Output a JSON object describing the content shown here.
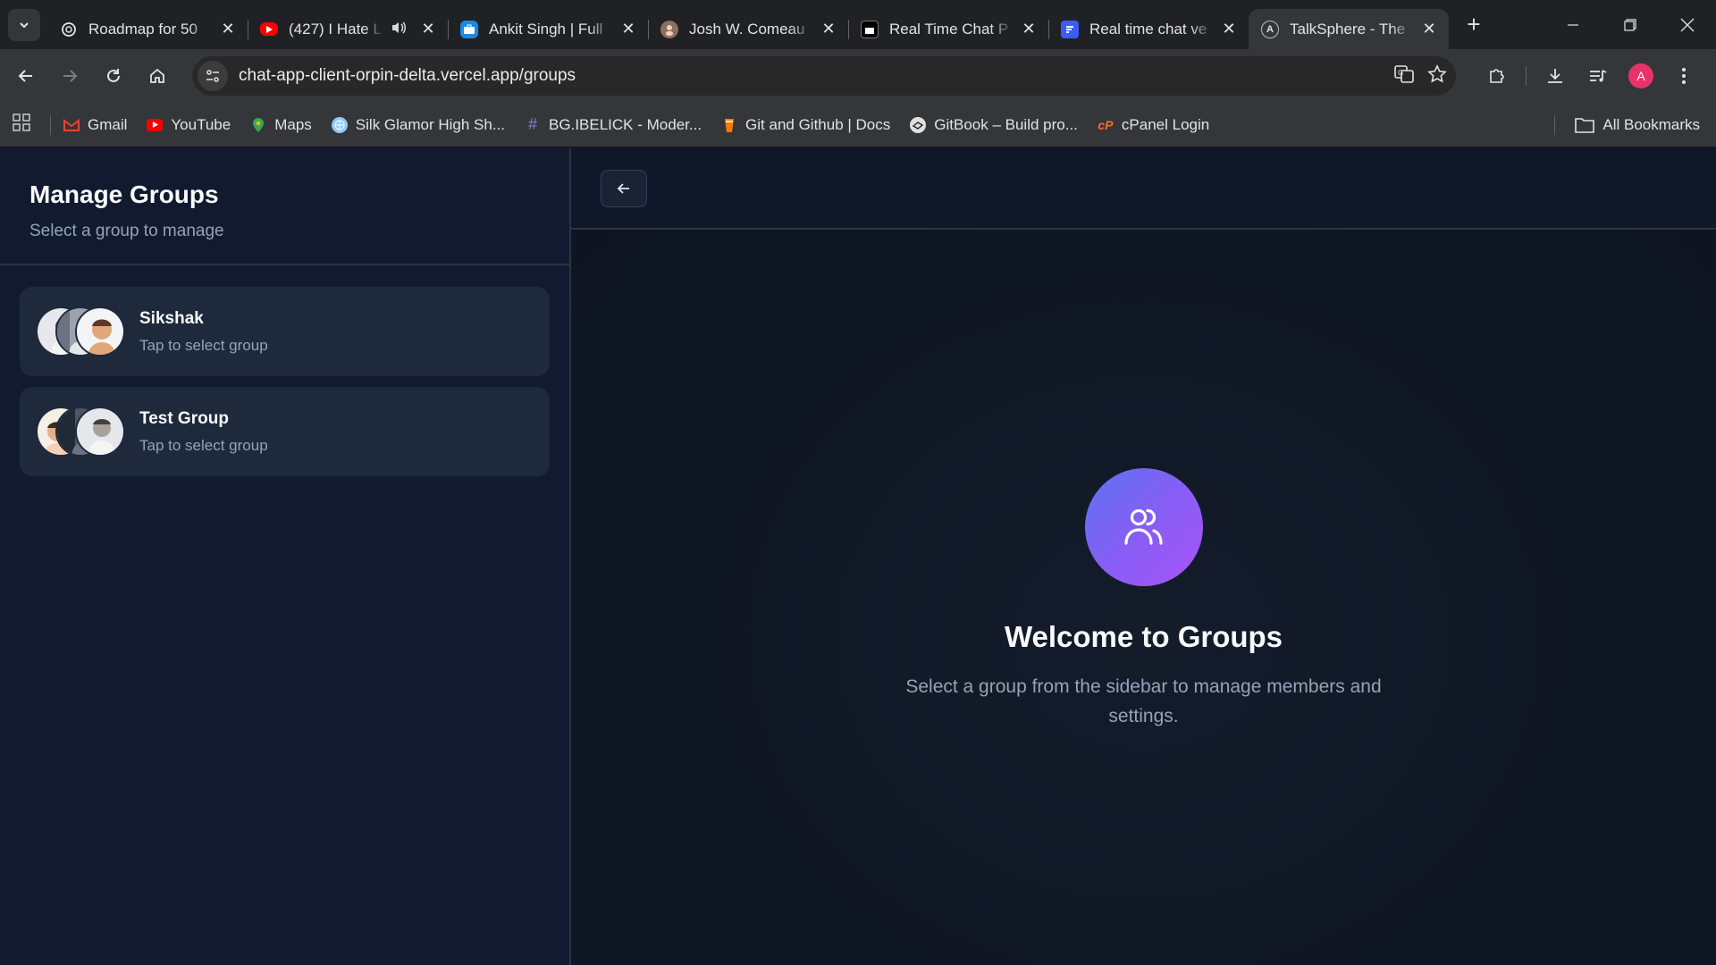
{
  "browser": {
    "tabs": [
      {
        "title": "Roadmap for 50",
        "icon": "openai-icon",
        "color": "#202124"
      },
      {
        "title": "(427) I Hate L",
        "icon": "youtube-icon",
        "color": "#ff0000",
        "audio": true
      },
      {
        "title": "Ankit Singh | Full",
        "icon": "briefcase-icon",
        "color": "#1e88e5"
      },
      {
        "title": "Josh W. Comeau",
        "icon": "avatar-icon",
        "color": "#8d6e63"
      },
      {
        "title": "Real Time Chat P",
        "icon": "site-icon",
        "color": "#000000"
      },
      {
        "title": "Real time chat ve",
        "icon": "docs-icon",
        "color": "#3b5cf6"
      },
      {
        "title": "TalkSphere - The",
        "icon": "talksphere-icon",
        "color": "#35363a",
        "active": true
      }
    ],
    "new_tab_label": "+",
    "url": "chat-app-client-orpin-delta.vercel.app/groups",
    "profile_initial": "A",
    "profile_color": "#e8336a",
    "bookmarks": [
      {
        "label": "Gmail",
        "icon": "gmail-icon",
        "color": "#ea4335"
      },
      {
        "label": "YouTube",
        "icon": "youtube-icon",
        "color": "#ff0000"
      },
      {
        "label": "Maps",
        "icon": "maps-icon",
        "color": "#34a853"
      },
      {
        "label": "Silk Glamor High Sh...",
        "icon": "globe-icon",
        "color": "#90caf9"
      },
      {
        "label": "BG.IBELICK - Moder...",
        "icon": "hash-icon",
        "color": "#7986cb"
      },
      {
        "label": "Git and Github | Docs",
        "icon": "git-icon",
        "color": "#f57c00"
      },
      {
        "label": "GitBook – Build pro...",
        "icon": "gitbook-icon",
        "color": "#e0e0e0"
      },
      {
        "label": "cPanel Login",
        "icon": "cpanel-icon",
        "color": "#ff6c2c"
      }
    ],
    "all_bookmarks_label": "All Bookmarks"
  },
  "sidebar": {
    "title": "Manage Groups",
    "subtitle": "Select a group to manage",
    "groups": [
      {
        "name": "Sikshak",
        "hint": "Tap to select group"
      },
      {
        "name": "Test Group",
        "hint": "Tap to select group"
      }
    ]
  },
  "main": {
    "welcome_title": "Welcome to Groups",
    "welcome_text": "Select a group from the sidebar to manage members and settings."
  },
  "colors": {
    "accent_gradient_start": "#5d73f0",
    "accent_gradient_end": "#a855f7",
    "background": "#0f172a",
    "card": "#1e293b"
  }
}
